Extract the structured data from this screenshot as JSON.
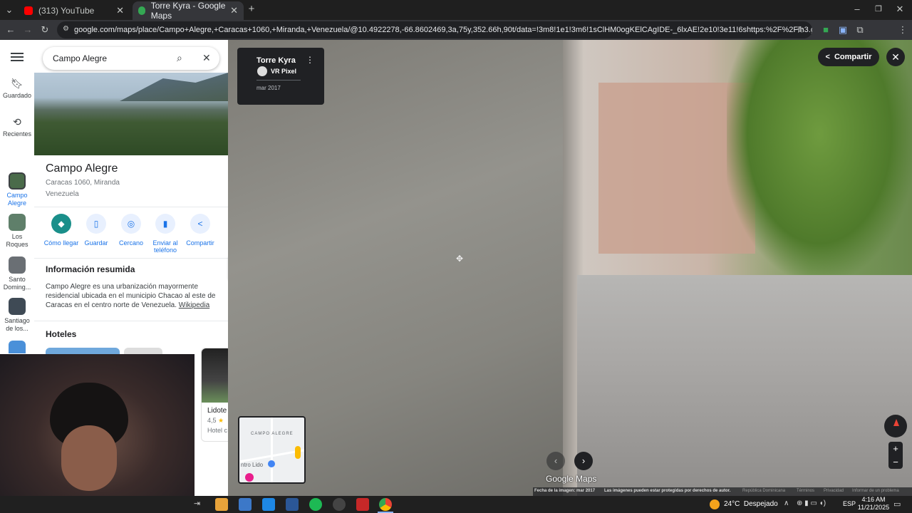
{
  "browser": {
    "tabs": [
      {
        "title": "(313) YouTube",
        "active": false
      },
      {
        "title": "Torre Kyra - Google Maps",
        "active": true
      }
    ],
    "url": "google.com/maps/place/Campo+Alegre,+Caracas+1060,+Miranda,+Venezuela/@10.4922278,-66.8602469,3a,75y,352.66h,90t/data=!3m8!1e1!3m6!1sClHM0ogKElCAgIDE-_6lxAE!2e10!3e11!6shttps:%2F%2Flh3.googleusercontent.com%2F..."
  },
  "rail": {
    "items": [
      {
        "label": "Guardado",
        "icon": "bookmark-icon"
      },
      {
        "label": "Recientes",
        "icon": "history-icon"
      },
      {
        "label": "Campo Alegre"
      },
      {
        "label": "Los Roques"
      },
      {
        "label": "Santo Doming..."
      },
      {
        "label": "Santiago de los..."
      }
    ]
  },
  "panel": {
    "search_value": "Campo Alegre",
    "place_name": "Campo Alegre",
    "address_line1": "Caracas 1060, Miranda",
    "address_line2": "Venezuela",
    "actions": [
      {
        "label": "Cómo llegar",
        "icon": "directions-icon"
      },
      {
        "label": "Guardar",
        "icon": "bookmark-icon"
      },
      {
        "label": "Cercano",
        "icon": "nearby-icon"
      },
      {
        "label": "Enviar al teléfono",
        "icon": "phone-icon"
      },
      {
        "label": "Compartir",
        "icon": "share-icon"
      }
    ],
    "summary_heading": "Información resumida",
    "summary_text": "Campo Alegre es una urbanización mayormente residencial ubicada en el municipio Chacao al este de Caracas en el centro norte de Venezuela.",
    "summary_link": "Wikipedia",
    "hotels_heading": "Hoteles",
    "hotel_card": {
      "name": "Lidote",
      "rating": "4,5",
      "type": "Hotel c"
    }
  },
  "streetview": {
    "title": "Torre Kyra",
    "author": "VR Pixel",
    "date": "mar 2017",
    "share_label": "Compartir",
    "brand": "Google Maps",
    "footer": {
      "image_date": "Fecha de la imagen: mar 2017",
      "copyright": "Las imágenes pueden estar protegidas por derechos de autor.",
      "country": "República Dominicana",
      "terms": "Términos",
      "privacy": "Privacidad",
      "report": "Informar de un problema"
    },
    "minimap_label": "CAMPO ALEGRE",
    "minimap_label2": "ntro Lido"
  },
  "taskbar": {
    "weather": "24°C  Despejado",
    "lang": "ESP",
    "time": "4:16 AM",
    "date": "11/21/2025"
  },
  "colors": {
    "accent": "#1a73e8",
    "dark": "#202124"
  }
}
